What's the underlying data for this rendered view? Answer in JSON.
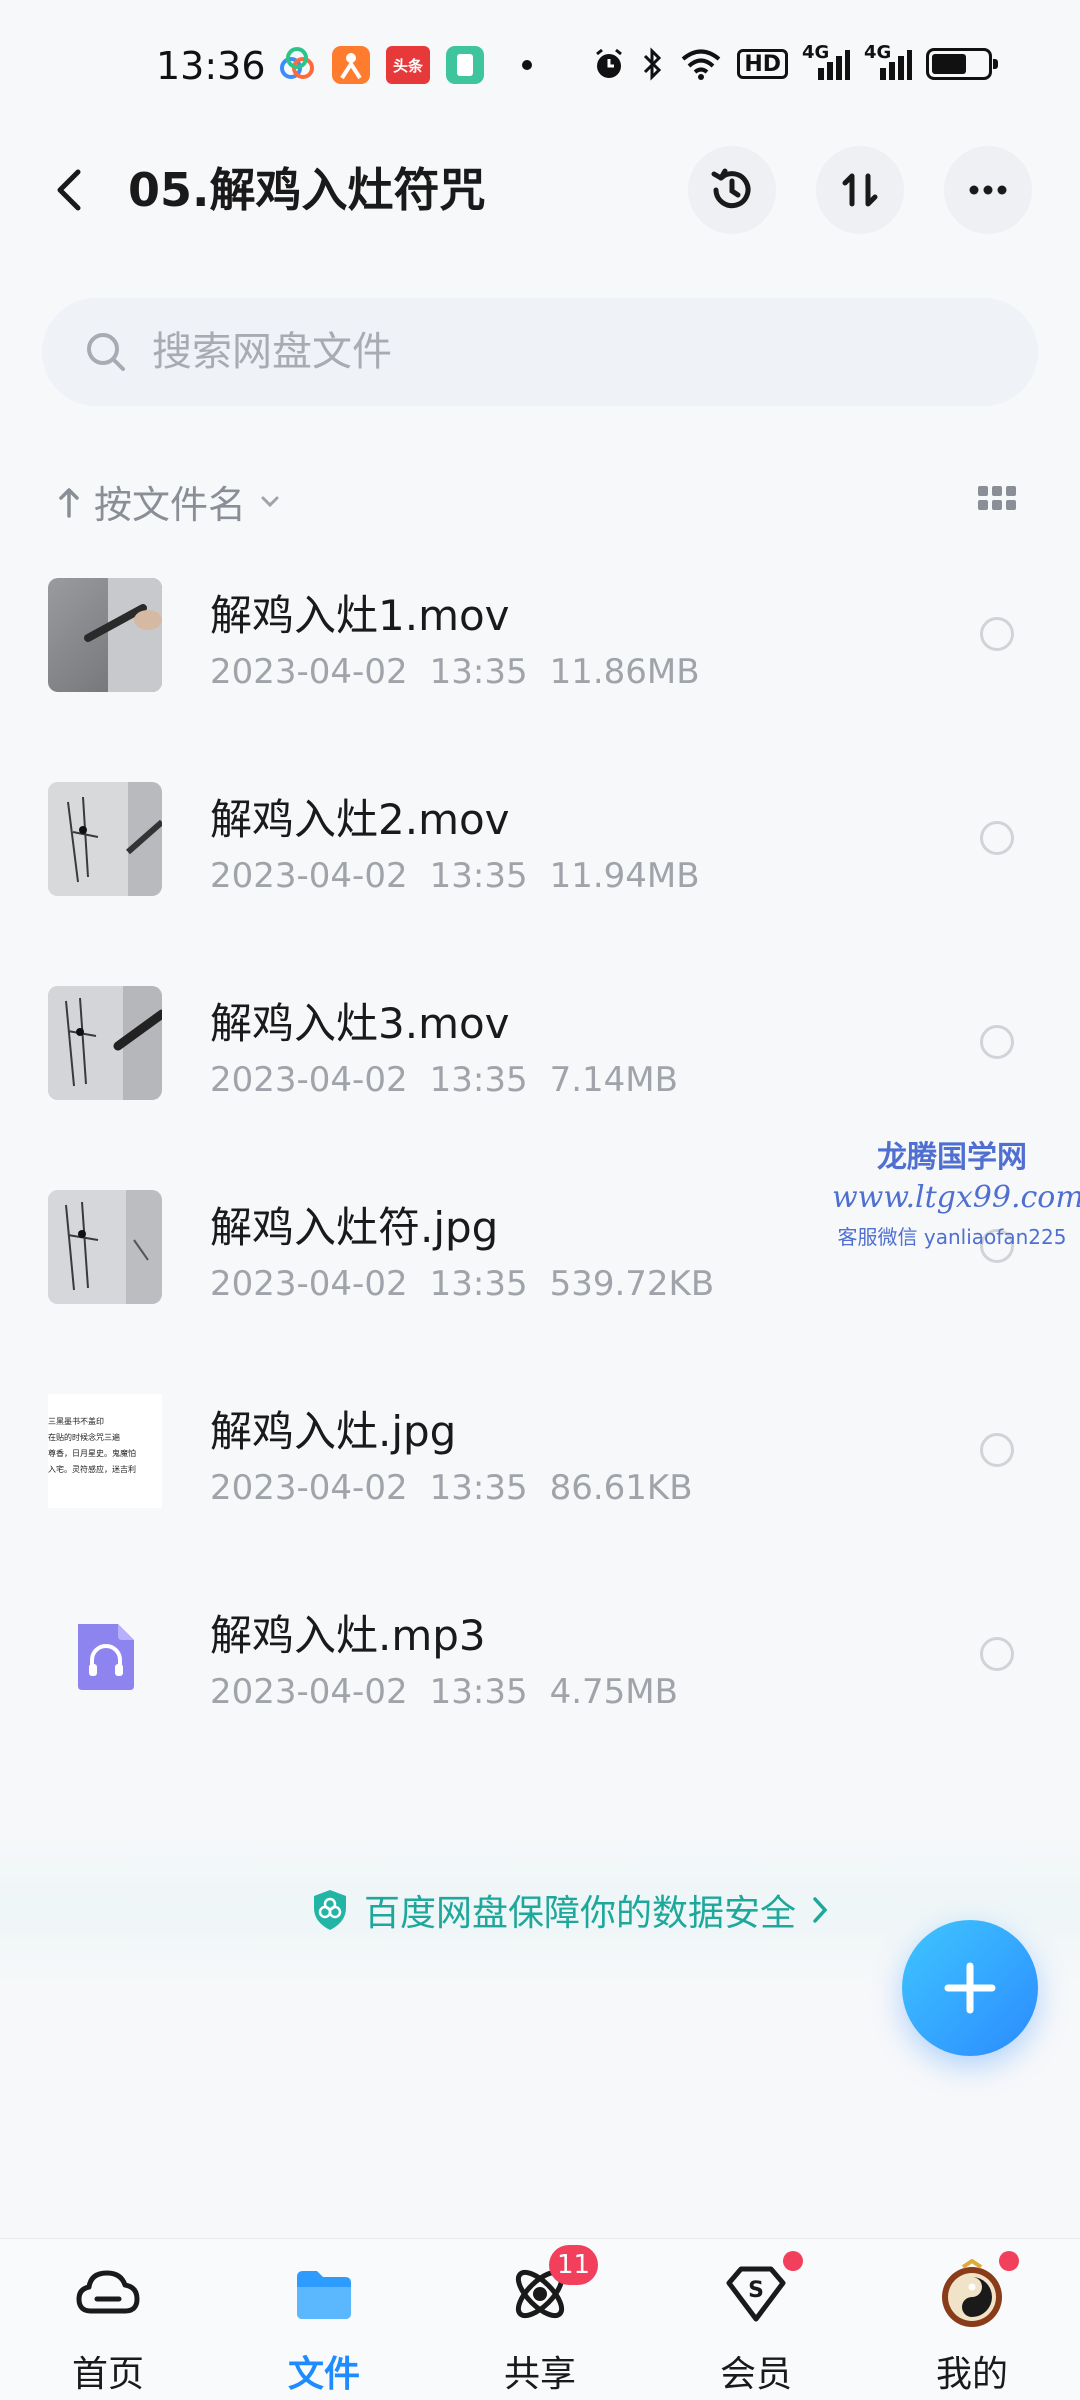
{
  "status_bar": {
    "time": "13:36",
    "apps": [
      "app-icon-1",
      "app-icon-2",
      "头条",
      "app-icon-4"
    ],
    "network": "4G",
    "hd": "HD"
  },
  "header": {
    "title": "05.解鸡入灶符咒",
    "icons": [
      "back-icon",
      "history-icon",
      "sort-icon",
      "more-icon"
    ]
  },
  "search": {
    "placeholder": "搜索网盘文件"
  },
  "sort": {
    "label": "按文件名"
  },
  "files": [
    {
      "name": "解鸡入灶1.mov",
      "date": "2023-04-02",
      "time": "13:35",
      "size": "11.86MB",
      "type": "video"
    },
    {
      "name": "解鸡入灶2.mov",
      "date": "2023-04-02",
      "time": "13:35",
      "size": "11.94MB",
      "type": "video"
    },
    {
      "name": "解鸡入灶3.mov",
      "date": "2023-04-02",
      "time": "13:35",
      "size": "7.14MB",
      "type": "video"
    },
    {
      "name": "解鸡入灶符.jpg",
      "date": "2023-04-02",
      "time": "13:35",
      "size": "539.72KB",
      "type": "image"
    },
    {
      "name": "解鸡入灶.jpg",
      "date": "2023-04-02",
      "time": "13:35",
      "size": "86.61KB",
      "type": "image-doc"
    },
    {
      "name": "解鸡入灶.mp3",
      "date": "2023-04-02",
      "time": "13:35",
      "size": "4.75MB",
      "type": "audio"
    }
  ],
  "thumb_doc_lines": [
    "三黑墨书不盖印",
    "在贴的时候念咒三遍",
    "尊香，日月星史。鬼魔怕",
    "入宅。灵符感应，迷吉利"
  ],
  "watermark": {
    "line1": "龙腾国学网",
    "line2": "www.ltgx99.com",
    "line3": "客服微信 yanliaofan225"
  },
  "security_banner": {
    "text": "百度网盘保障你的数据安全"
  },
  "bottom_nav": {
    "items": [
      {
        "label": "首页",
        "icon": "home-cloud-icon"
      },
      {
        "label": "文件",
        "icon": "folder-icon"
      },
      {
        "label": "共享",
        "icon": "share-orbit-icon",
        "badge": "11"
      },
      {
        "label": "会员",
        "icon": "vip-diamond-icon"
      },
      {
        "label": "我的",
        "icon": "avatar"
      }
    ],
    "active_index": 1
  },
  "colors": {
    "accent": "#1e8cff",
    "secure": "#1ea89b",
    "badge": "#f23f5b"
  }
}
